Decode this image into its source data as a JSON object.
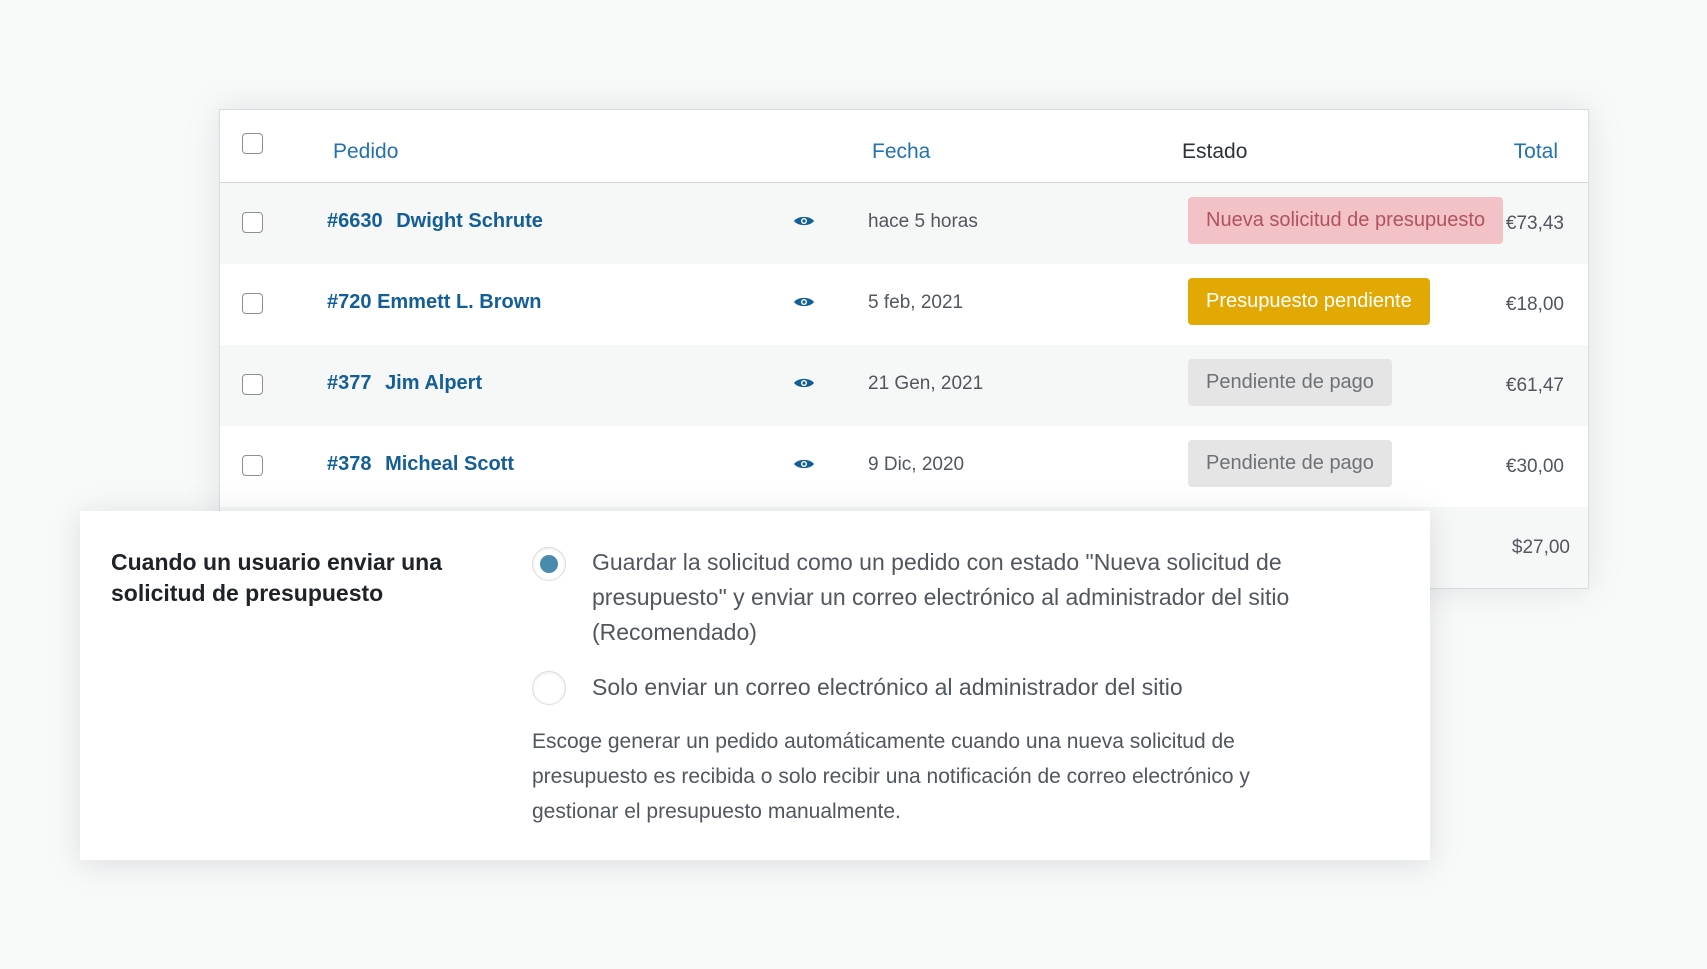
{
  "orders": {
    "headers": {
      "pedido": "Pedido",
      "fecha": "Fecha",
      "estado": "Estado",
      "total": "Total"
    },
    "rows": [
      {
        "number": "#6630",
        "customer": "Dwight Schrute",
        "date": "hace 5 horas",
        "status": "Nueva solicitud de presupuesto",
        "status_bg": "#f2c2c6",
        "status_color": "#b0535c",
        "total": "€73,43"
      },
      {
        "number": "#720",
        "customer": "Emmett L. Brown",
        "date": "5 feb, 2021",
        "status": "Presupuesto pendiente",
        "status_bg": "#e2a904",
        "status_color": "#ffffff",
        "total": "€18,00"
      },
      {
        "number": "#377",
        "customer": "Jim Alpert",
        "date": "21 Gen, 2021",
        "status": "Pendiente de pago",
        "status_bg": "#e5e5e5",
        "status_color": "#6d7277",
        "total": "€61,47"
      },
      {
        "number": "#378",
        "customer": "Micheal Scott",
        "date": "9 Dic, 2020",
        "status": "Pendiente de pago",
        "status_bg": "#e5e5e5",
        "status_color": "#6d7277",
        "total": "€30,00"
      },
      {
        "total": "$27,00"
      }
    ]
  },
  "settings": {
    "label": "Cuando un usuario enviar una solicitud de presupuesto",
    "options": [
      {
        "text": "Guardar la solicitud como un pedido con estado \"Nueva solicitud de presupuesto\" y enviar un correo electrónico al administrador del sitio (Recomendado)",
        "selected": true
      },
      {
        "text": "Solo enviar un correo electrónico al administrador del sitio",
        "selected": false
      }
    ],
    "description": "Escoge generar un pedido automáticamente cuando una nueva solicitud de presupuesto es recibida o solo recibir una notificación de correo electrónico y gestionar el presupuesto manualmente."
  },
  "colors": {
    "link": "#2271b1",
    "radio_selected": "#4a8aad"
  },
  "icons": {
    "row_action": "eye-icon"
  }
}
